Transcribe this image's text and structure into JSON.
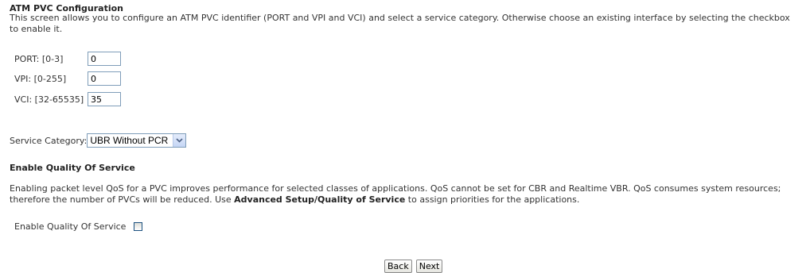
{
  "header": {
    "title": "ATM PVC Configuration",
    "intro": "This screen allows you to configure an ATM PVC identifier (PORT and VPI and VCI) and select a service category. Otherwise choose an existing interface by selecting the checkbox to enable it."
  },
  "fields": {
    "port": {
      "label": "PORT: [0-3]",
      "value": "0"
    },
    "vpi": {
      "label": "VPI: [0-255]",
      "value": "0"
    },
    "vci": {
      "label": "VCI: [32-65535]",
      "value": "35"
    }
  },
  "service": {
    "label": "Service Category:",
    "selected": "UBR Without PCR"
  },
  "qos": {
    "heading": "Enable Quality Of Service",
    "desc_part1": "Enabling packet level QoS for a PVC improves performance for selected classes of applications.  QoS cannot be set for CBR and Realtime VBR.  QoS consumes system resources; therefore the number of PVCs will be reduced. Use ",
    "desc_bold": "Advanced Setup/Quality of Service",
    "desc_part2": " to assign priorities for the applications.",
    "checkbox_label": "Enable Quality Of Service",
    "checked": false
  },
  "buttons": {
    "back": "Back",
    "next": "Next"
  },
  "icons": {
    "dropdown": "chevron-down-icon"
  }
}
